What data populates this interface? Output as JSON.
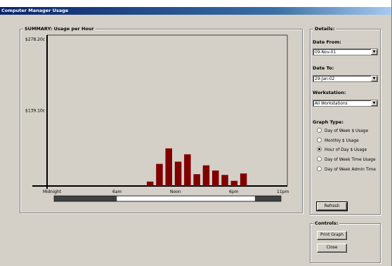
{
  "window": {
    "title": "Computer Manager Usage"
  },
  "summary": {
    "group_title": "SUMMARY: Usage per Hour",
    "y_ticks": [
      "$278.20c",
      "$139.10c"
    ],
    "x_ticks": [
      "Midnight",
      "6am",
      "Noon",
      "6pm",
      "11pm"
    ]
  },
  "details": {
    "group_title": "Details:",
    "date_from_label": "Date From:",
    "date_from_value": "09-Nov-01",
    "date_to_label": "Date To:",
    "date_to_value": "29-Jan-02",
    "workstation_label": "Workstation:",
    "workstation_value": "All Workstations",
    "graph_type_label": "Graph Type:",
    "graph_types": [
      {
        "label": "Day of Week $ Usage",
        "checked": false
      },
      {
        "label": "Monthly $ Usage",
        "checked": false
      },
      {
        "label": "Hour of Day $ Usage",
        "checked": true
      },
      {
        "label": "Day of Week Time Usage",
        "checked": false
      },
      {
        "label": "Day of Week Admin Time",
        "checked": false
      }
    ],
    "refresh_label": "Refresh"
  },
  "controls": {
    "group_title": "Controls:",
    "print_label": "Print Graph",
    "close_label": "Close"
  },
  "chart_data": {
    "type": "bar",
    "categories": [
      "0",
      "1",
      "2",
      "3",
      "4",
      "5",
      "6",
      "7",
      "8",
      "9",
      "10",
      "11",
      "12",
      "13",
      "14",
      "15",
      "16",
      "17",
      "18",
      "19",
      "20",
      "21",
      "22",
      "23"
    ],
    "values": [
      0,
      0,
      0,
      0,
      0,
      0,
      0,
      0,
      0,
      0,
      6,
      30,
      51,
      33,
      43,
      16,
      28,
      21,
      15,
      7,
      17,
      0,
      0,
      0
    ],
    "ylim": [
      0,
      278.2
    ],
    "bar_color": "#800000",
    "highlight_range_hours": [
      6,
      20
    ]
  }
}
